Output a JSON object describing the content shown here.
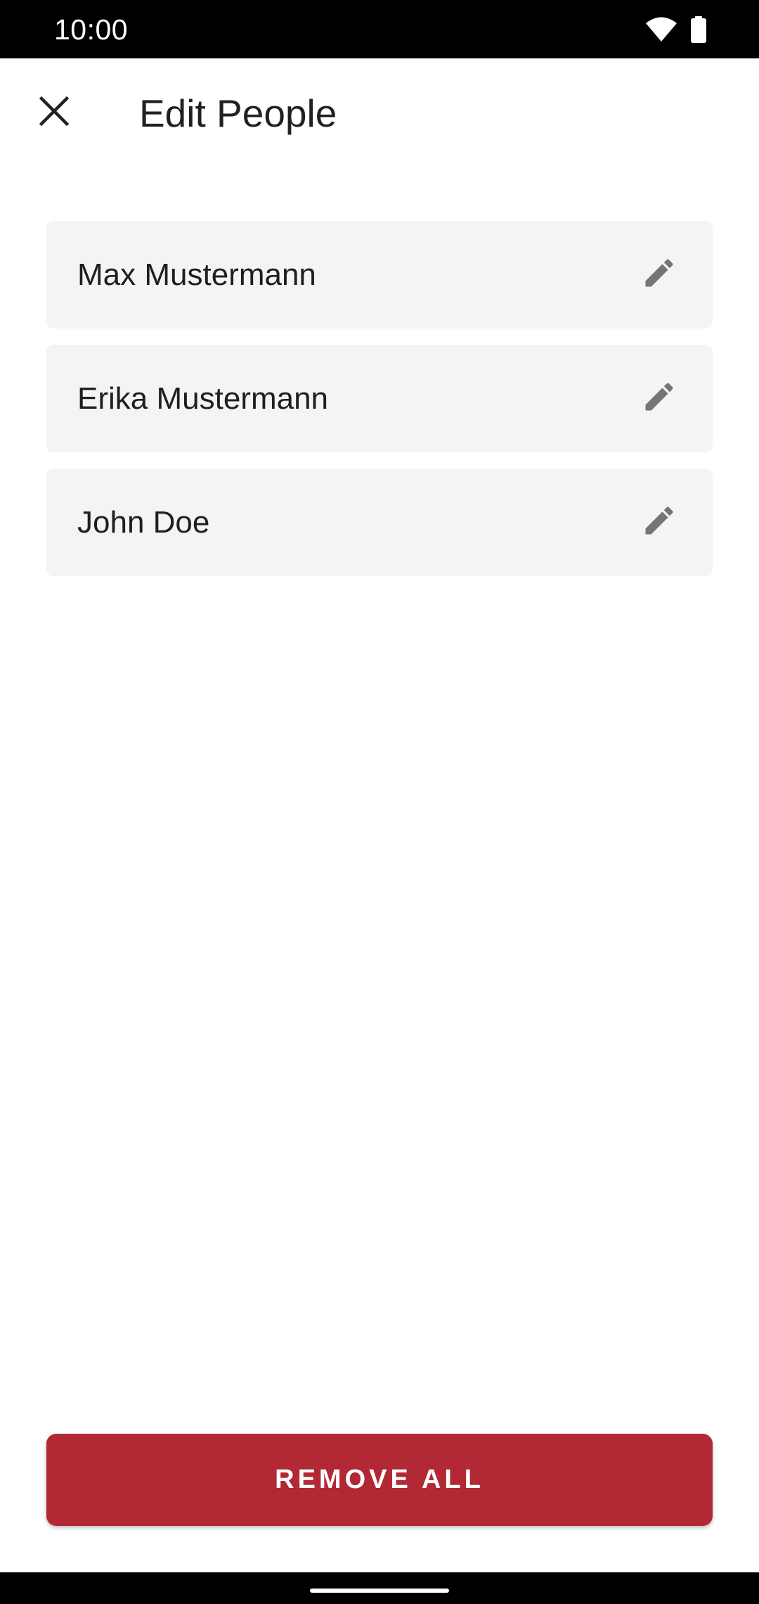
{
  "status_bar": {
    "time": "10:00",
    "icons": [
      "wifi-icon",
      "battery-icon"
    ]
  },
  "app_bar": {
    "close_icon": "close-icon",
    "title": "Edit People"
  },
  "people": [
    {
      "name": "Max Mustermann",
      "action_icon": "pencil-icon"
    },
    {
      "name": "Erika Mustermann",
      "action_icon": "pencil-icon"
    },
    {
      "name": "John Doe",
      "action_icon": "pencil-icon"
    }
  ],
  "remove_all": {
    "label": "REMOVE ALL",
    "color": "#b22834"
  },
  "colors": {
    "status_bar_bg": "#000000",
    "card_bg": "#f4f4f4",
    "icon_gray": "#757575",
    "accent_red": "#b22834"
  }
}
